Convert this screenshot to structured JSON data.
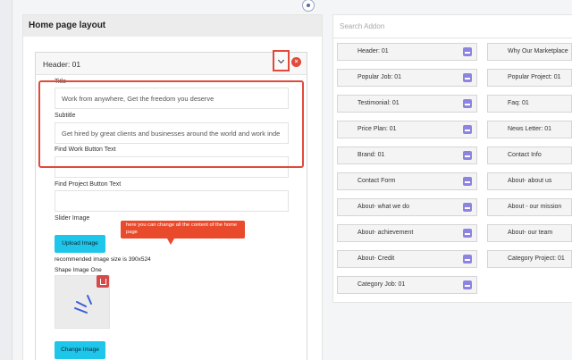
{
  "layout": {
    "title": "Home page layout",
    "card_title": "Header: 01",
    "fields": {
      "title_label": "Title",
      "title_value": "Work from anywhere, Get the freedom you deserve",
      "subtitle_label": "Subtitle",
      "subtitle_value": "Get hired by great clients and businesses around the world and work inde",
      "find_work_label": "Find Work Button Text",
      "find_work_value": "",
      "find_project_label": "Find Project Button Text",
      "find_project_value": "",
      "slider_image_label": "Slider Image",
      "upload_label": "Upload Image",
      "size_note": "recommended image size is 390x524",
      "shape_image_label": "Shape Image One",
      "change_label": "Change Image"
    },
    "tooltip": "here you can change all the content of the home page"
  },
  "addons": {
    "search_placeholder": "Search Addon",
    "left": [
      "Header: 01",
      "Popular Job: 01",
      "Testimonial: 01",
      "Price Plan: 01",
      "Brand: 01",
      "Contact Form",
      "About- what we do",
      "About- achievement",
      "About- Credit",
      "Category Job: 01"
    ],
    "right": [
      "Why Our Marketplace",
      "Popular Project: 01",
      "Faq: 01",
      "News Letter: 01",
      "Contact Info",
      "About- about us",
      "About - our mission",
      "About- our team",
      "Category Project: 01"
    ]
  },
  "colors": {
    "accent_red": "#e14a3a",
    "cyan_button": "#1ec6ea",
    "icon_purple": "#8c84e0"
  }
}
